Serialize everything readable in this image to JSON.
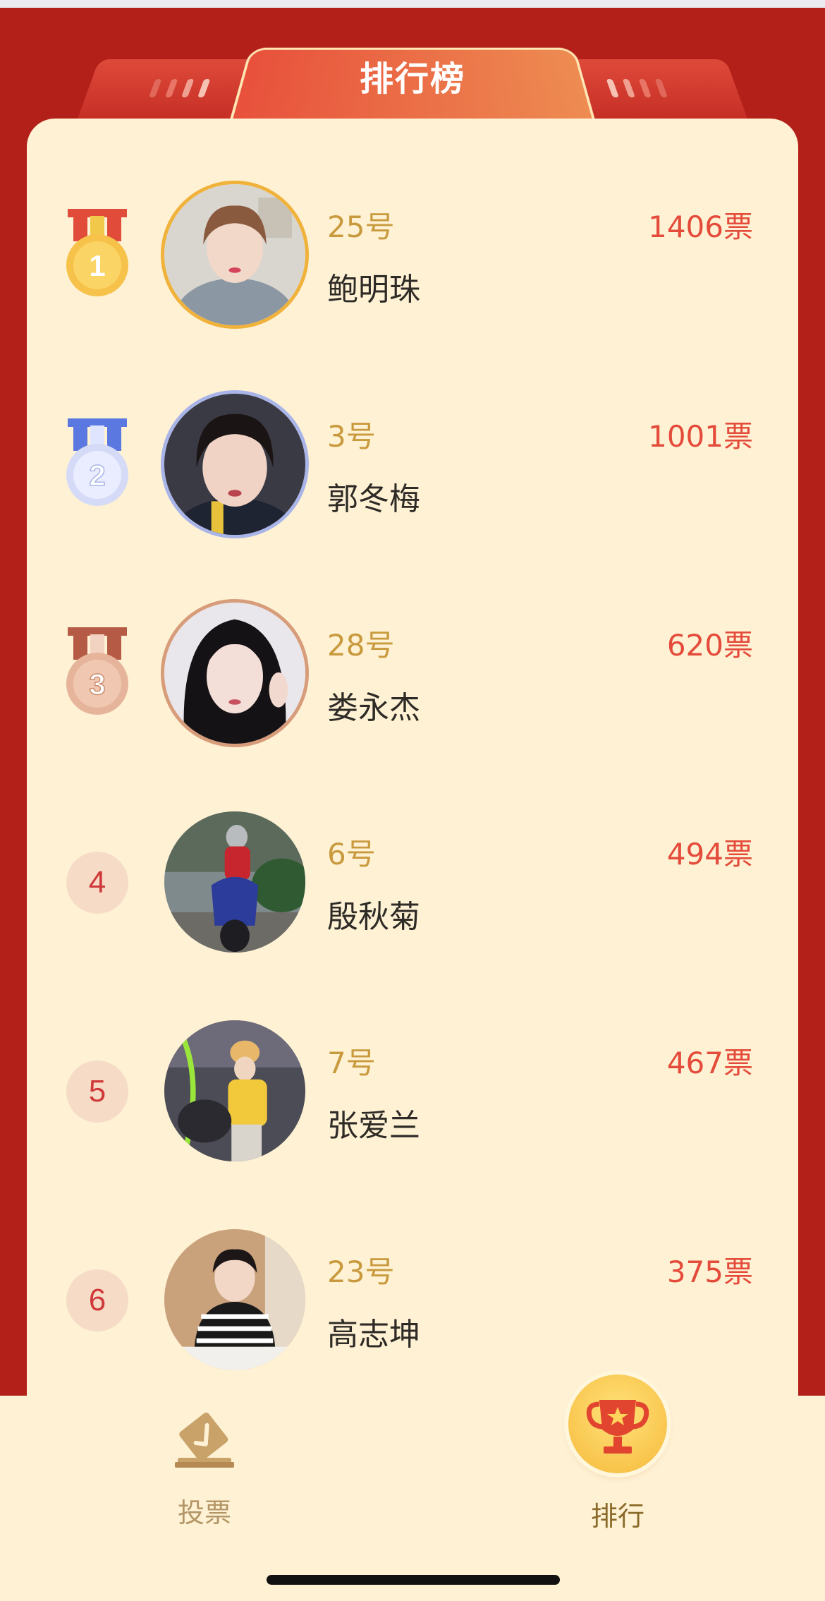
{
  "header": {
    "title": "排行榜"
  },
  "ranking": [
    {
      "rank": "1",
      "number": "25号",
      "name": "鲍明珠",
      "votes": "1406票"
    },
    {
      "rank": "2",
      "number": "3号",
      "name": "郭冬梅",
      "votes": "1001票"
    },
    {
      "rank": "3",
      "number": "28号",
      "name": "娄永杰",
      "votes": "620票"
    },
    {
      "rank": "4",
      "number": "6号",
      "name": "殷秋菊",
      "votes": "494票"
    },
    {
      "rank": "5",
      "number": "7号",
      "name": "张爱兰",
      "votes": "467票"
    },
    {
      "rank": "6",
      "number": "23号",
      "name": "高志坤",
      "votes": "375票"
    }
  ],
  "bottom_nav": {
    "vote_label": "投票",
    "rank_label": "排行",
    "vote_icon": "ballot-box-icon",
    "rank_icon": "trophy-icon",
    "active": "排行"
  },
  "colors": {
    "background": "#b32019",
    "card": "#fef1d4",
    "number": "#c99a3d",
    "votes": "#e44b3a",
    "gold": "#f0b23a",
    "silver": "#a9b5e8",
    "bronze": "#d79c7a"
  }
}
